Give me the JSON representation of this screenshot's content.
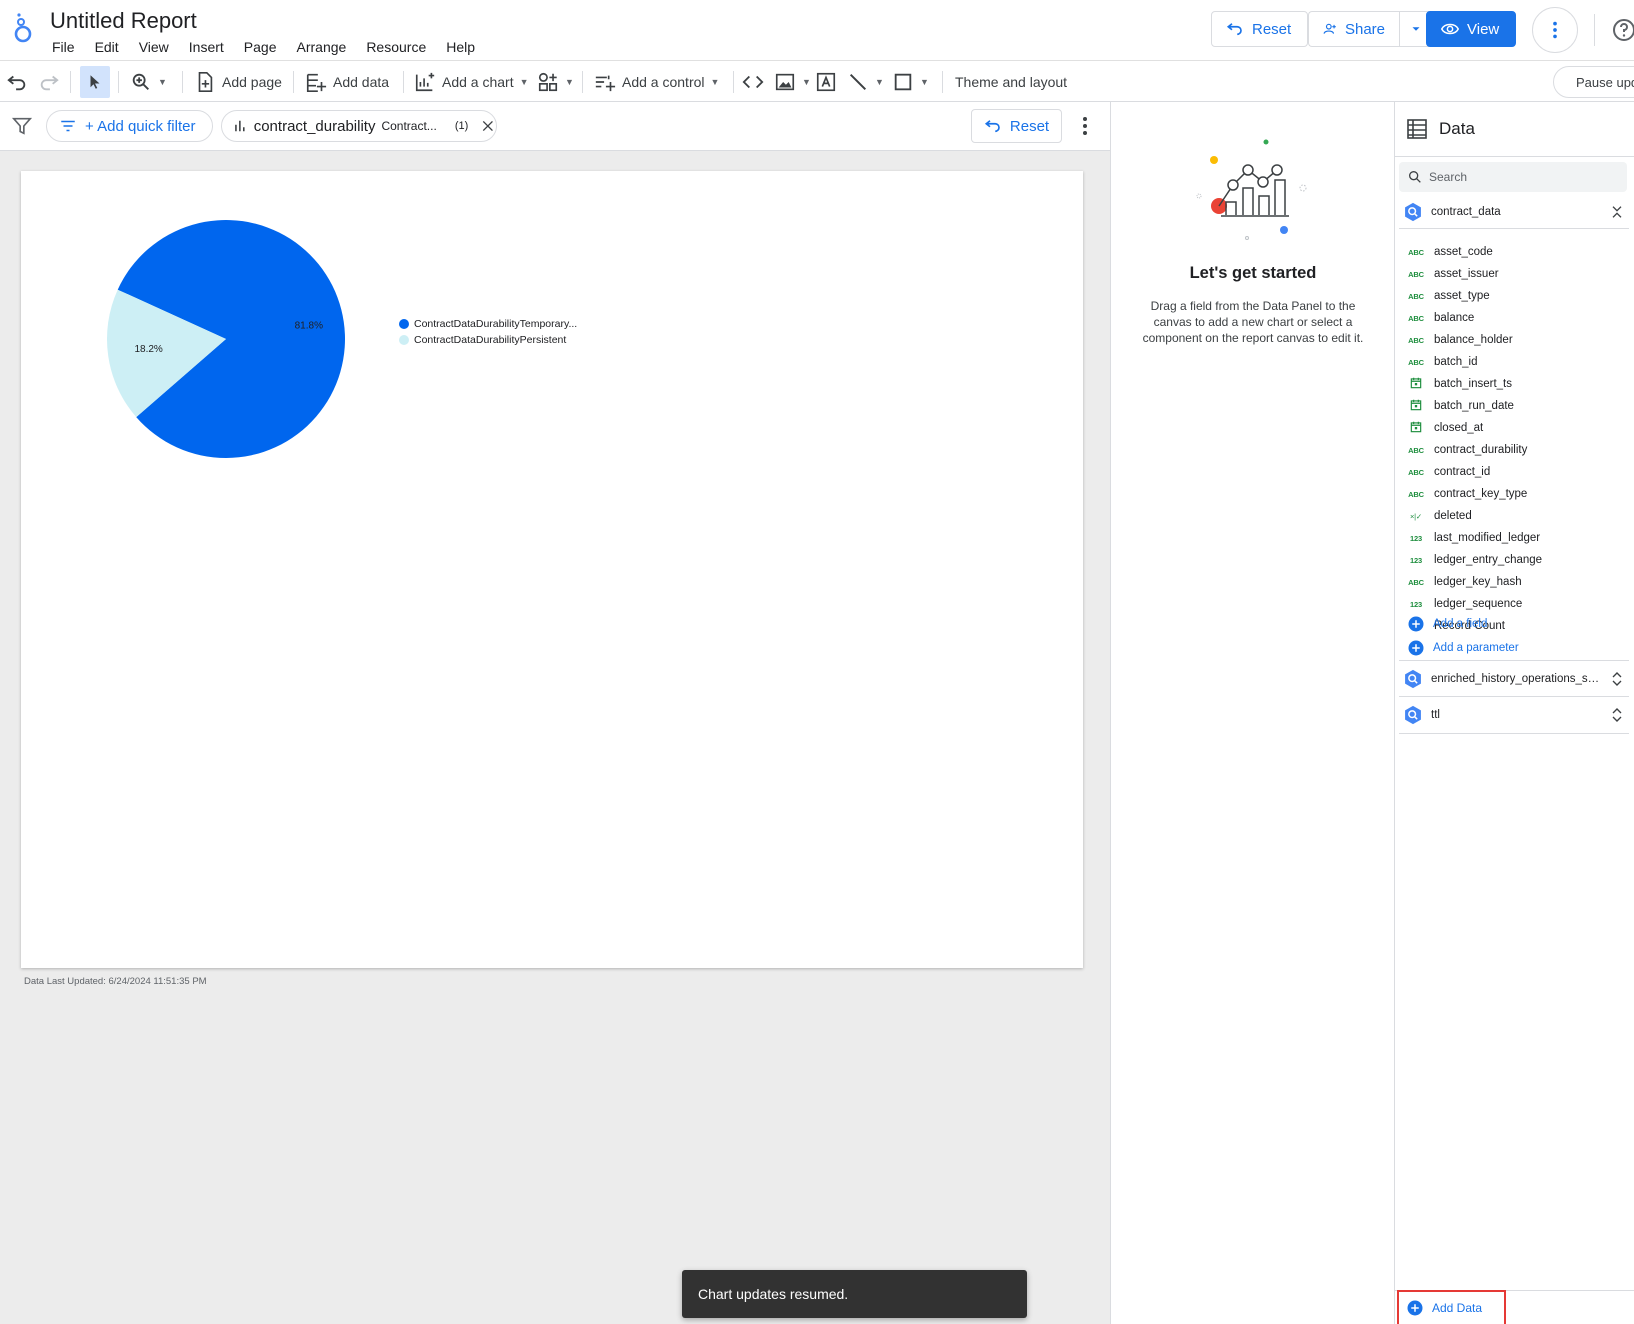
{
  "header": {
    "title": "Untitled Report",
    "menu": [
      "File",
      "Edit",
      "View",
      "Insert",
      "Page",
      "Arrange",
      "Resource",
      "Help"
    ],
    "reset_label": "Reset",
    "share_label": "Share",
    "view_label": "View"
  },
  "toolbar": {
    "add_page": "Add page",
    "add_data": "Add data",
    "add_chart": "Add a chart",
    "add_control": "Add a control",
    "theme_layout": "Theme and layout",
    "pause_label": "Pause updates"
  },
  "filterbar": {
    "add_quick_filter": "+ Add quick filter",
    "chip_field": "contract_durability",
    "chip_value": "Contract...",
    "chip_count": "(1)",
    "reset_label": "Reset"
  },
  "chart_data": {
    "type": "pie",
    "slices": [
      {
        "label": "ContractDataDurabilityTemporary...",
        "value": 81.8,
        "color": "#0066ee"
      },
      {
        "label": "ContractDataDurabilityPersistent",
        "value": 18.2,
        "color": "#cdeff5"
      }
    ],
    "data_labels": [
      "81.8%",
      "18.2%"
    ],
    "legend_position": "right"
  },
  "canvas": {
    "last_updated": "Data Last Updated: 6/24/2024 11:51:35 PM"
  },
  "start_panel": {
    "title": "Let's get started",
    "description": "Drag a field from the Data Panel to the canvas to add a new chart or select a component on the report canvas to edit it."
  },
  "data_panel": {
    "title": "Data",
    "search_placeholder": "Search",
    "datasource_primary": "contract_data",
    "fields": [
      {
        "type": "ABC",
        "name": "asset_code"
      },
      {
        "type": "ABC",
        "name": "asset_issuer"
      },
      {
        "type": "ABC",
        "name": "asset_type"
      },
      {
        "type": "ABC",
        "name": "balance"
      },
      {
        "type": "ABC",
        "name": "balance_holder"
      },
      {
        "type": "ABC",
        "name": "batch_id"
      },
      {
        "type": "date",
        "name": "batch_insert_ts"
      },
      {
        "type": "date",
        "name": "batch_run_date"
      },
      {
        "type": "date",
        "name": "closed_at"
      },
      {
        "type": "ABC",
        "name": "contract_durability"
      },
      {
        "type": "ABC",
        "name": "contract_id"
      },
      {
        "type": "ABC",
        "name": "contract_key_type"
      },
      {
        "type": "bool",
        "name": "deleted"
      },
      {
        "type": "123",
        "name": "last_modified_ledger"
      },
      {
        "type": "123",
        "name": "ledger_entry_change"
      },
      {
        "type": "ABC",
        "name": "ledger_key_hash"
      },
      {
        "type": "123",
        "name": "ledger_sequence"
      },
      {
        "type": "123m",
        "name": "Record Count"
      }
    ],
    "add_field": "Add a field",
    "add_parameter": "Add a parameter",
    "datasource_2": "enriched_history_operations_sorob...",
    "datasource_3": "ttl",
    "add_data": "Add Data"
  },
  "toast": {
    "message": "Chart updates resumed."
  },
  "colors": {
    "accent": "#1a73e8",
    "highlight_box": "#e53935"
  }
}
